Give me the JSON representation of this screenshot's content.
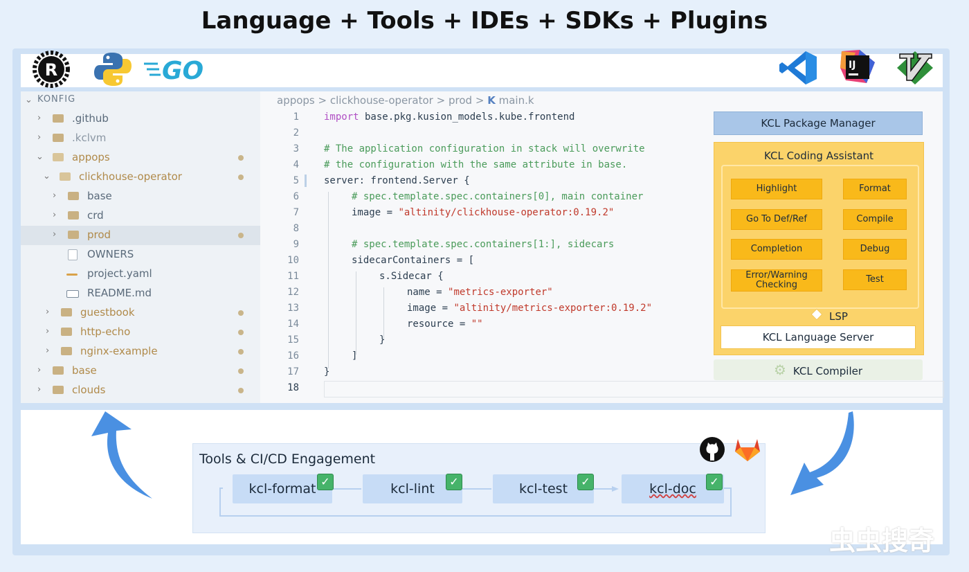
{
  "title": "Language + Tools + IDEs + SDKs + Plugins",
  "logos": {
    "left": [
      "rust-logo",
      "python-logo",
      "go-logo"
    ],
    "go_text": "GO",
    "right": [
      "vscode-logo",
      "intellij-logo",
      "vim-logo"
    ],
    "rust_letter": "R",
    "ij_letters": "IJ"
  },
  "explorer": {
    "root": "KONFIG",
    "items": [
      {
        "label": ".github",
        "dot": false
      },
      {
        "label": ".kclvm",
        "dot": false
      },
      {
        "label": "appops",
        "dot": true
      },
      {
        "label": "clickhouse-operator",
        "dot": true
      },
      {
        "label": "base",
        "dot": false
      },
      {
        "label": "crd",
        "dot": false
      },
      {
        "label": "prod",
        "dot": true
      },
      {
        "label": "OWNERS",
        "dot": false
      },
      {
        "label": "project.yaml",
        "dot": false
      },
      {
        "label": "README.md",
        "dot": false
      },
      {
        "label": "guestbook",
        "dot": true
      },
      {
        "label": "http-echo",
        "dot": true
      },
      {
        "label": "nginx-example",
        "dot": true
      },
      {
        "label": "base",
        "dot": true
      },
      {
        "label": "clouds",
        "dot": true
      }
    ]
  },
  "breadcrumb": {
    "parts": [
      "appops",
      "clickhouse-operator",
      "prod"
    ],
    "sep": ">",
    "file_icon": "K",
    "file": "main.k"
  },
  "code": {
    "line_numbers": [
      "1",
      "2",
      "3",
      "4",
      "5",
      "6",
      "7",
      "8",
      "9",
      "10",
      "11",
      "12",
      "13",
      "14",
      "15",
      "16",
      "17",
      "18"
    ],
    "l1_kw": "import",
    "l1_rest": " base.pkg.kusion_models.kube.frontend",
    "l3": "# The application configuration in stack will overwrite",
    "l4": "# the configuration with the same attribute in base.",
    "l5": "server: frontend.Server {",
    "l6": "# spec.template.spec.containers[0], main container",
    "l7_a": "image = ",
    "l7_s": "\"altinity/clickhouse-operator:0.19.2\"",
    "l9": "# spec.template.spec.containers[1:], sidecars",
    "l10": "sidecarContainers = [",
    "l11": "s.Sidecar {",
    "l12_a": "name = ",
    "l12_s": "\"metrics-exporter\"",
    "l13_a": "image = ",
    "l13_s": "\"altinity/metrics-exporter:0.19.2\"",
    "l14_a": "resource = ",
    "l14_s": "\"\"",
    "l15": "}",
    "l16": "]",
    "l17": "}"
  },
  "kcl": {
    "package_manager": "KCL Package Manager",
    "assistant_title": "KCL Coding Assistant",
    "features_left": [
      "Highlight",
      "Go To Def/Ref",
      "Completion",
      "Error/Warning Checking"
    ],
    "features_right": [
      "Format",
      "Compile",
      "Debug",
      "Test"
    ],
    "lsp": "LSP",
    "language_server": "KCL Language Server",
    "compiler": "KCL Compiler"
  },
  "cicd": {
    "title": "Tools & CI/CD Engagement",
    "tools": [
      "kcl-format",
      "kcl-lint",
      "kcl-test",
      "kcl-doc"
    ],
    "check_mark": "✓",
    "platform_icons": [
      "github-icon",
      "gitlab-icon"
    ]
  },
  "watermark": "虫虫搜奇",
  "colors": {
    "assistant_bg": "#fbd36a",
    "feature_btn": "#f9b91a",
    "package_manager": "#a9c6e8",
    "tool_box": "#c7dcf6",
    "arrow": "#4a90e2",
    "check": "#46b36a"
  }
}
